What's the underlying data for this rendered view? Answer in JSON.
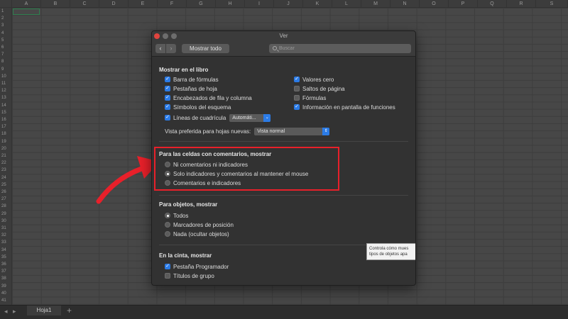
{
  "sheet": {
    "columns": [
      "A",
      "B",
      "C",
      "D",
      "E",
      "F",
      "G",
      "H",
      "I",
      "J",
      "K",
      "L",
      "M",
      "N",
      "O",
      "P",
      "Q",
      "R",
      "S"
    ],
    "rows": [
      "1",
      "2",
      "3",
      "4",
      "5",
      "6",
      "7",
      "8",
      "9",
      "10",
      "11",
      "12",
      "13",
      "14",
      "15",
      "16",
      "17",
      "18",
      "19",
      "20",
      "21",
      "22",
      "23",
      "24",
      "25",
      "26",
      "27",
      "28",
      "29",
      "30",
      "31",
      "32",
      "33",
      "34",
      "35",
      "36",
      "37",
      "38",
      "39",
      "40",
      "41"
    ],
    "tab_name": "Hoja1",
    "add_tab": "+"
  },
  "dialog": {
    "title": "Ver",
    "back": "‹",
    "forward": "›",
    "show_all": "Mostrar todo",
    "search_placeholder": "Buscar"
  },
  "libro": {
    "title": "Mostrar en el libro",
    "left_items": [
      {
        "label": "Barra de fórmulas",
        "checked": true
      },
      {
        "label": "Pestañas de hoja",
        "checked": true
      },
      {
        "label": "Encabezados de fila y columna",
        "checked": true
      },
      {
        "label": "Símbolos del esquema",
        "checked": true
      }
    ],
    "right_items": [
      {
        "label": "Valores cero",
        "checked": true
      },
      {
        "label": "Saltos de página",
        "checked": false
      },
      {
        "label": "Fórmulas",
        "checked": false
      },
      {
        "label": "Información en pantalla de funciones",
        "checked": true
      }
    ],
    "gridlines_label": "Líneas de cuadrícula",
    "gridlines_value": "Automáti...",
    "view_label": "Vista preferida para hojas nuevas:",
    "view_value": "Vista normal"
  },
  "comentarios": {
    "title": "Para las celdas con comentarios, mostrar",
    "options": [
      {
        "label": "Ni comentarios ni indicadores",
        "selected": false
      },
      {
        "label": "Solo indicadores y comentarios al mantener el mouse",
        "selected": true
      },
      {
        "label": "Comentarios e indicadores",
        "selected": false
      }
    ]
  },
  "objetos": {
    "title": "Para objetos, mostrar",
    "options": [
      {
        "label": "Todos",
        "selected": true
      },
      {
        "label": "Marcadores de posición",
        "selected": false
      },
      {
        "label": "Nada (ocultar objetos)",
        "selected": false
      }
    ]
  },
  "cinta": {
    "title": "En la cinta, mostrar",
    "items": [
      {
        "label": "Pestaña Programador",
        "checked": true
      },
      {
        "label": "Títulos de grupo",
        "checked": false
      }
    ]
  },
  "tooltip": {
    "line1": "Controla cómo mues",
    "line2": "tipos de objetos apa"
  },
  "colors": {
    "accent": "#2b7be6",
    "highlight": "#e8202a",
    "close": "#e0443e"
  }
}
